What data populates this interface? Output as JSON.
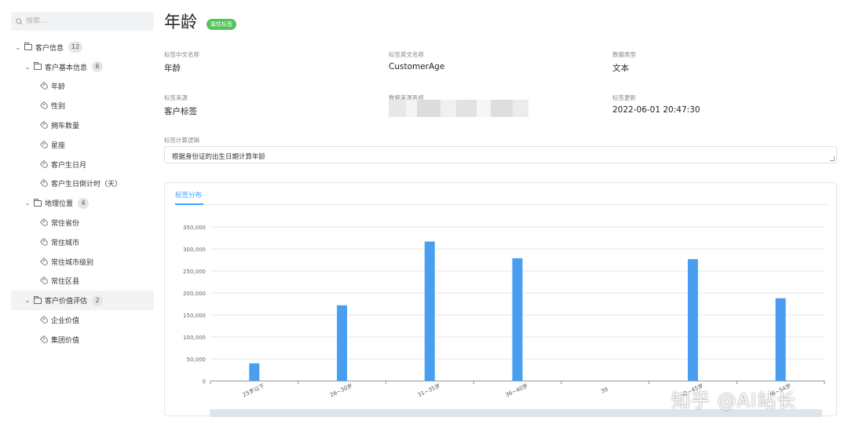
{
  "sidebar": {
    "search_placeholder": "搜索...",
    "tree": [
      {
        "label": "客户信息",
        "count": "12",
        "level": 0,
        "type": "folder"
      },
      {
        "label": "客户基本信息",
        "count": "6",
        "level": 1,
        "type": "folder"
      },
      {
        "label": "年龄",
        "level": 2,
        "type": "tag"
      },
      {
        "label": "性别",
        "level": 2,
        "type": "tag"
      },
      {
        "label": "拥车数量",
        "level": 2,
        "type": "tag"
      },
      {
        "label": "星座",
        "level": 2,
        "type": "tag"
      },
      {
        "label": "客户生日月",
        "level": 2,
        "type": "tag"
      },
      {
        "label": "客户生日倒计时（天）",
        "level": 2,
        "type": "tag"
      },
      {
        "label": "地理位置",
        "count": "4",
        "level": 1,
        "type": "folder"
      },
      {
        "label": "常住省份",
        "level": 2,
        "type": "tag"
      },
      {
        "label": "常住城市",
        "level": 2,
        "type": "tag"
      },
      {
        "label": "常住城市级别",
        "level": 2,
        "type": "tag"
      },
      {
        "label": "常住区县",
        "level": 2,
        "type": "tag"
      },
      {
        "label": "客户价值评估",
        "count": "2",
        "level": 1,
        "type": "folder",
        "selected": true
      },
      {
        "label": "企业价值",
        "level": 2,
        "type": "tag"
      },
      {
        "label": "集团价值",
        "level": 2,
        "type": "tag"
      }
    ]
  },
  "header": {
    "title": "年龄",
    "badge": "属性标签"
  },
  "fields": {
    "cn_name_label": "标签中文名称",
    "cn_name_value": "年龄",
    "en_name_label": "标签英文名称",
    "en_name_value": "CustomerAge",
    "type_label": "数据类型",
    "type_value": "文本",
    "source_label": "标签来源",
    "source_value": "客户标签",
    "system_label": "数据来源系统",
    "updated_label": "标签更新",
    "updated_value": "2022-06-01 20:47:30",
    "logic_label": "标签计算逻辑",
    "logic_value": "根据身份证的出生日期计算年龄"
  },
  "tab": {
    "label": "标签分布"
  },
  "colors": {
    "bar": "#4a9ef0",
    "accent": "#409eff",
    "badge": "#52c25a"
  },
  "chart_data": {
    "type": "bar",
    "categories": [
      "25岁以下",
      "26~30岁",
      "31~35岁",
      "36~40岁",
      "39",
      "41~45岁",
      "46~54岁"
    ],
    "values": [
      40000,
      172000,
      317000,
      279000,
      0,
      277000,
      188000
    ],
    "ylim": [
      0,
      350000
    ],
    "yticks": [
      "0",
      "50,000",
      "100,000",
      "150,000",
      "200,000",
      "250,000",
      "300,000",
      "350,000"
    ],
    "grid": true
  },
  "watermark": "知乎 @AI站长"
}
